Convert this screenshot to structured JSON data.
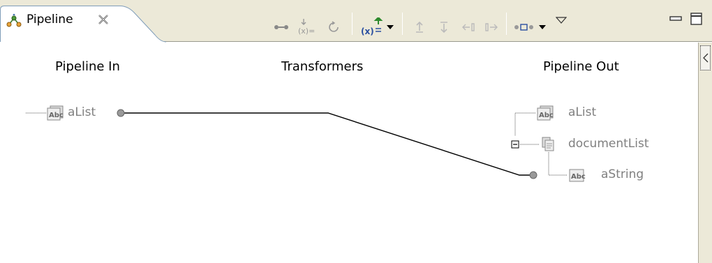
{
  "view": {
    "tab_label": "Pipeline"
  },
  "toolbar": {
    "icons": [
      "link-icon",
      "drop-variable-icon",
      "map-icon",
      "insert-transformer-icon",
      "dropdown-arrow-icon",
      "move-up-icon",
      "move-down-icon",
      "move-left-icon",
      "move-right-icon",
      "layout-icon",
      "view-menu-icon",
      "minimize-icon",
      "maximize-icon"
    ]
  },
  "columns": {
    "pipeline_in": "Pipeline In",
    "transformers": "Transformers",
    "pipeline_out": "Pipeline Out"
  },
  "pipeline_in": {
    "variables": [
      {
        "name": "aList",
        "type_icon": "string-icon"
      }
    ]
  },
  "pipeline_out": {
    "variables": [
      {
        "name": "aList",
        "type_icon": "string-icon"
      },
      {
        "name": "documentList",
        "type_icon": "document-list-icon",
        "expanded": true
      },
      {
        "name": "aString",
        "type_icon": "string-icon"
      }
    ]
  },
  "mappings": [
    {
      "from": "aList",
      "to": "documentList/aString"
    }
  ],
  "colors": {
    "chrome": "#ece9d8",
    "label_gray": "#808080",
    "tab_icon_orange": "#e8a33a"
  }
}
